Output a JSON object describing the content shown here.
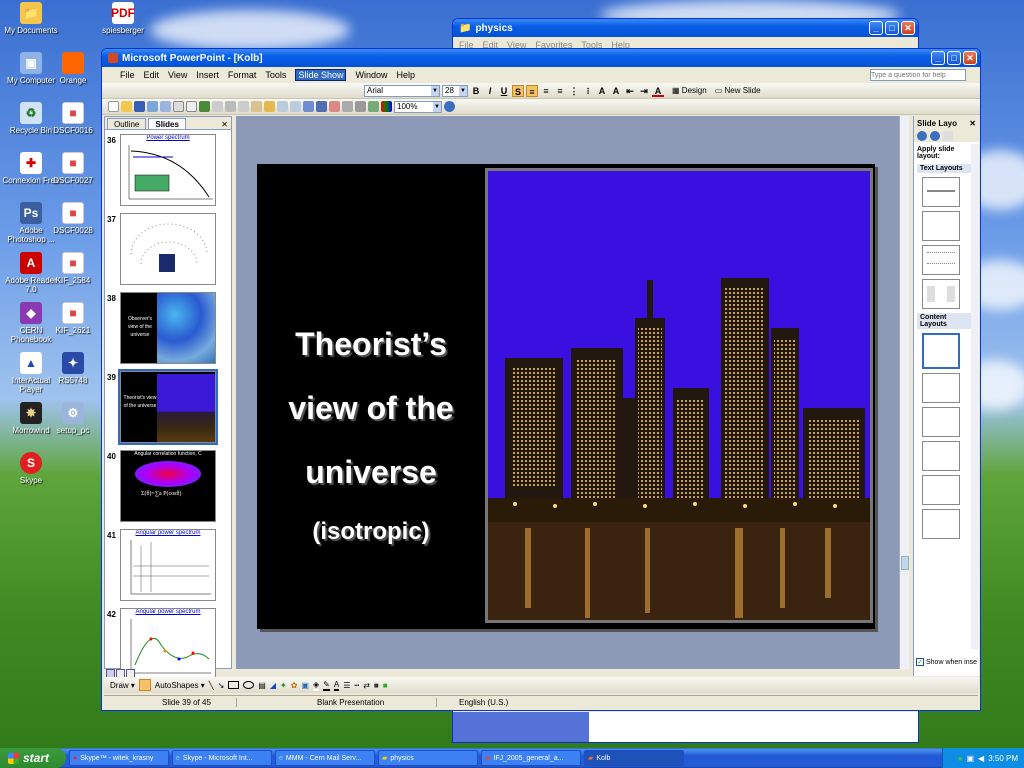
{
  "desktop": {
    "icons": [
      {
        "label": "My Documents"
      },
      {
        "label": "spiesberger"
      },
      {
        "label": "My Computer"
      },
      {
        "label": "Orange"
      },
      {
        "label": "Recycle Bin"
      },
      {
        "label": "DSCF0016"
      },
      {
        "label": "Connexion Free"
      },
      {
        "label": "DSCF0027"
      },
      {
        "label": "Adobe Photoshop ..."
      },
      {
        "label": "DSCF0028"
      },
      {
        "label": "Adobe Reader 7.0"
      },
      {
        "label": "KIF_2584"
      },
      {
        "label": "CERN Phonebook"
      },
      {
        "label": "KIF_2621"
      },
      {
        "label": "InterActual Player"
      },
      {
        "label": "RS5748"
      },
      {
        "label": "Morrowind"
      },
      {
        "label": "setup_pc"
      },
      {
        "label": "Skype"
      }
    ]
  },
  "physics_window": {
    "title": "physics",
    "menu": [
      "File",
      "Edit",
      "View",
      "Favorites",
      "Tools",
      "Help"
    ]
  },
  "ppt": {
    "title": "Microsoft PowerPoint - [Kolb]",
    "menu": [
      "File",
      "Edit",
      "View",
      "Insert",
      "Format",
      "Tools",
      "Slide Show",
      "Window",
      "Help"
    ],
    "help_placeholder": "Type a question for help",
    "font_name": "Arial",
    "font_size": "28",
    "zoom": "100%",
    "design_label": "Design",
    "new_slide_label": "New Slide",
    "panel_tabs": [
      "Outline",
      "Slides"
    ],
    "thumbnails": [
      {
        "num": "36",
        "caption": "Power spectrum"
      },
      {
        "num": "37",
        "caption": ""
      },
      {
        "num": "38",
        "caption": "Observer's view of the universe"
      },
      {
        "num": "39",
        "caption": "Theorist's view of the universe"
      },
      {
        "num": "40",
        "caption": "Angular correlation function, C"
      },
      {
        "num": "41",
        "caption": "Angular power spectrum"
      },
      {
        "num": "42",
        "caption": "Angular power spectrum"
      }
    ],
    "slide": {
      "line1": "Theorist’s",
      "line2": "view of the",
      "line3": "universe",
      "line4": "(isotropic)"
    },
    "task_pane": {
      "title": "Slide Layo",
      "apply_label": "Apply slide layout:",
      "text_layouts": "Text Layouts",
      "content_layouts": "Content Layouts",
      "show_insert": "Show when inse"
    },
    "draw_label": "Draw",
    "autoshapes_label": "AutoShapes",
    "status": {
      "slide": "Slide 39 of 45",
      "design": "Blank Presentation",
      "language": "English (U.S.)"
    }
  },
  "taskbar": {
    "start": "start",
    "items": [
      "Skype™ - witek_krasny",
      "Skype - Microsoft Int...",
      "MMM - Cern Mail Serv...",
      "physics",
      "IFJ_2005_general_a...",
      "Kolb"
    ],
    "clock": "3:50 PM"
  }
}
